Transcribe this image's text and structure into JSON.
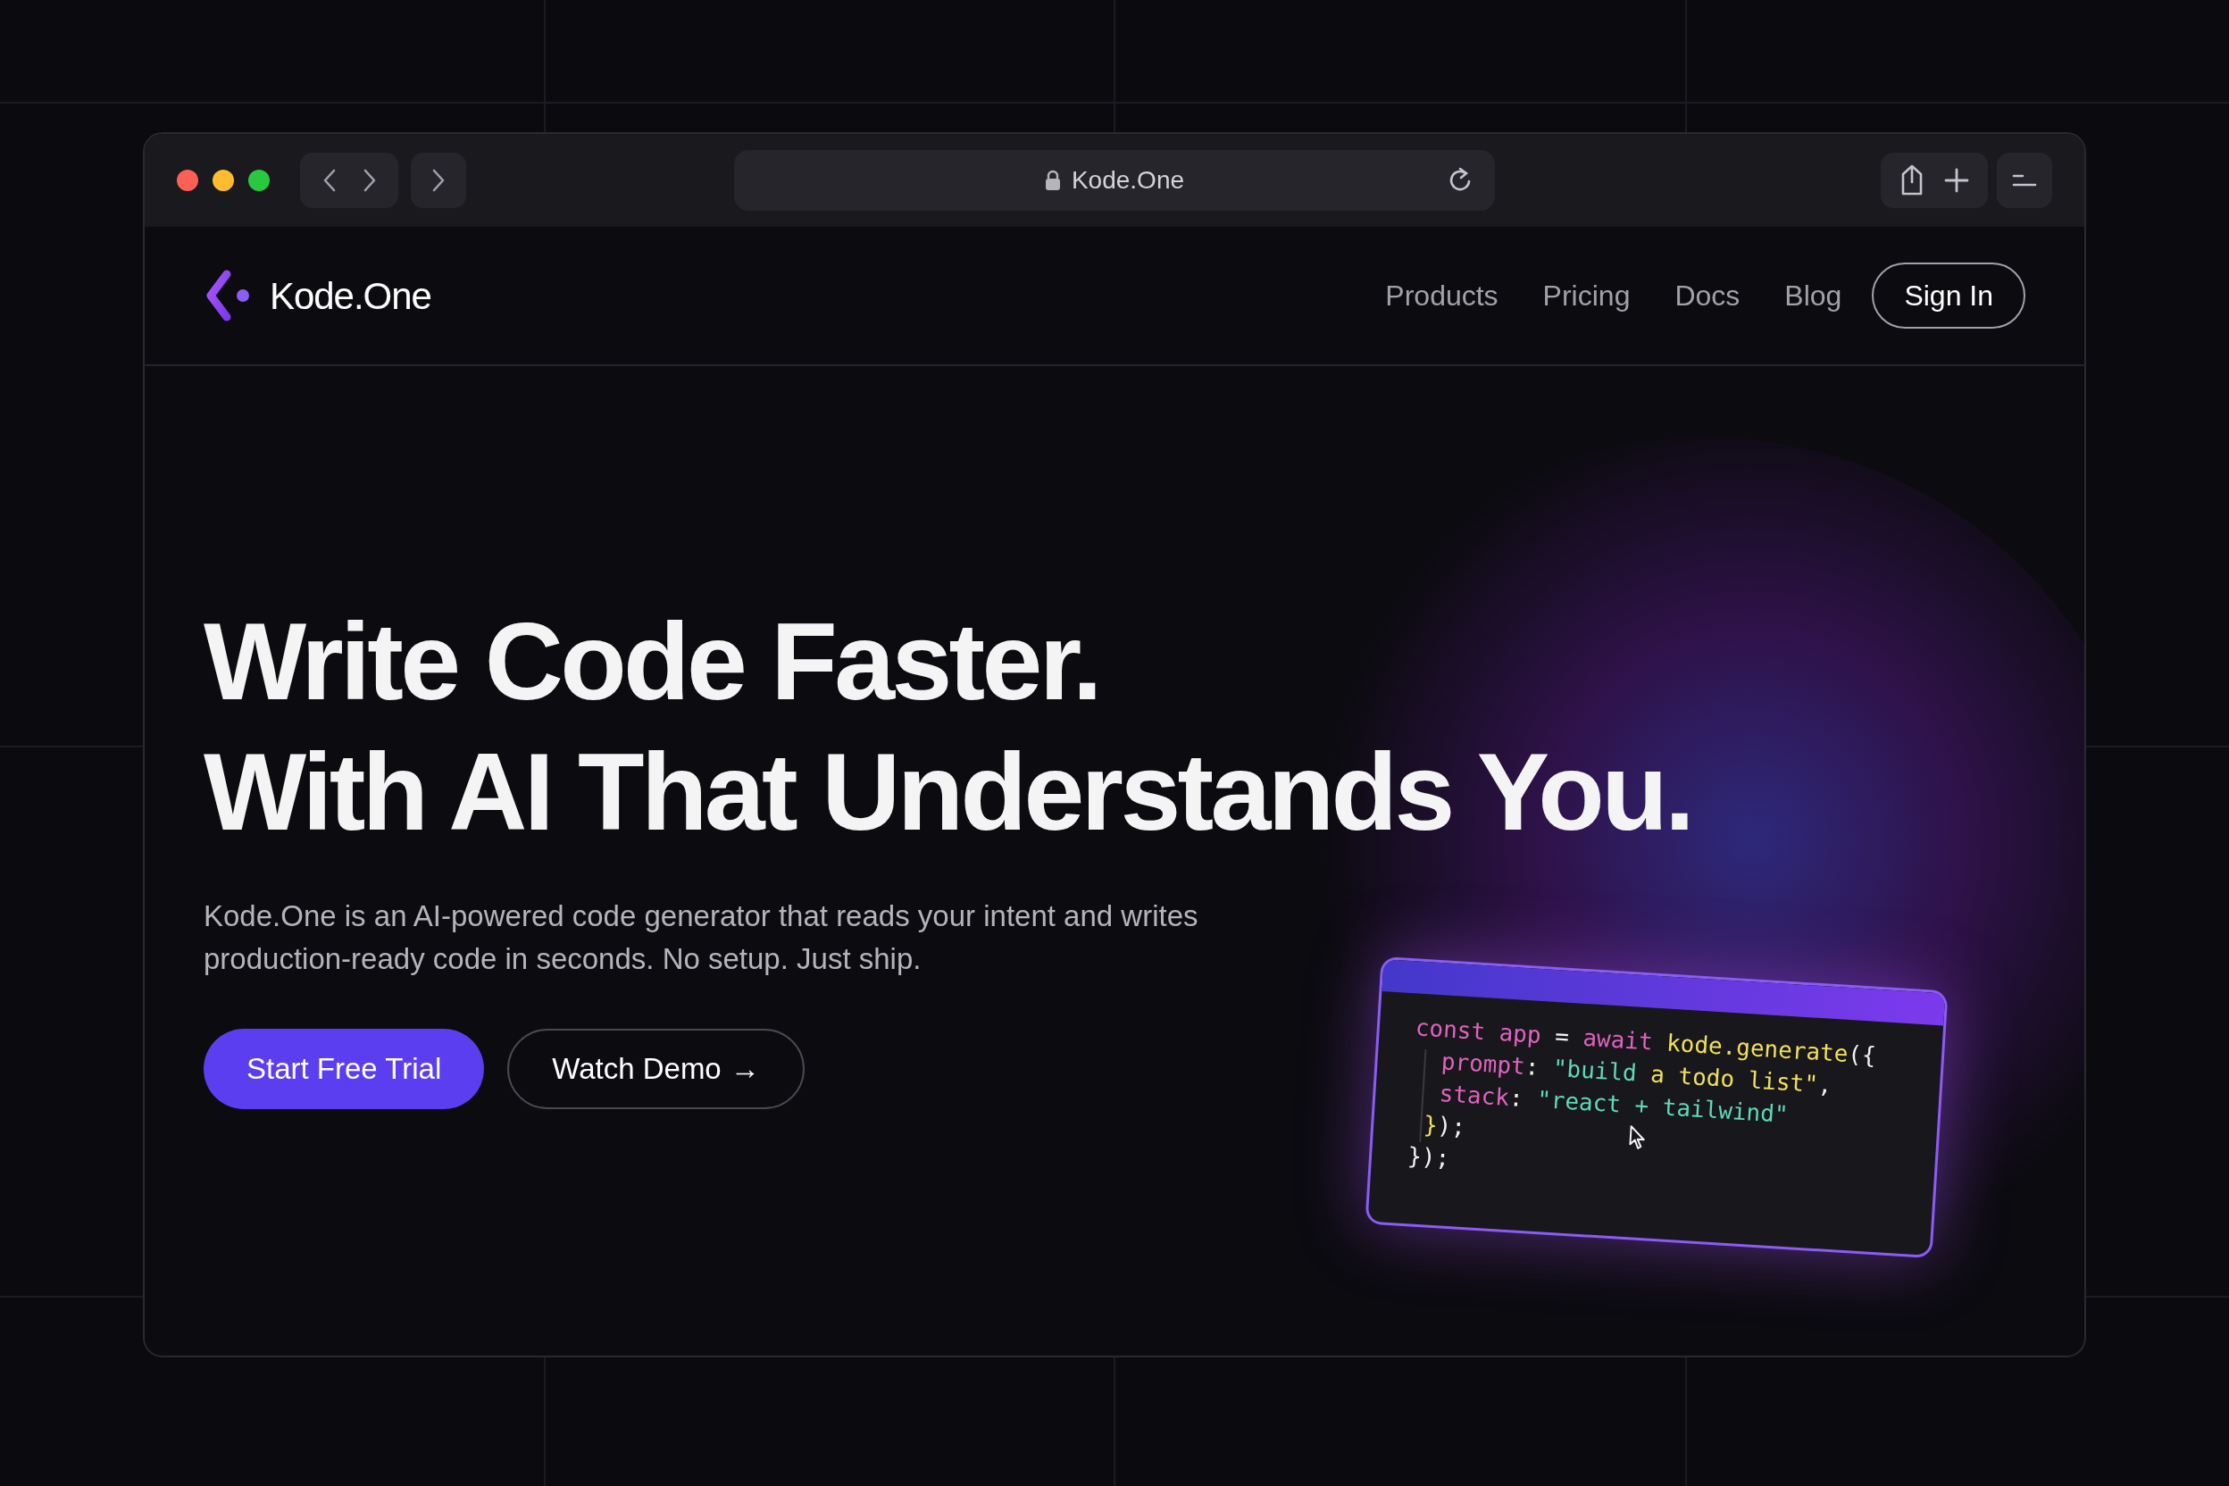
{
  "browser": {
    "address": "Kode.One"
  },
  "nav": {
    "brand": "Kode.One",
    "links": [
      "Products",
      "Pricing",
      "Docs",
      "Blog"
    ],
    "sign_in": "Sign In"
  },
  "hero": {
    "title_lines": [
      "Write Code Faster.",
      "With AI That Understands You."
    ],
    "description": "Kode.One is an AI-powered code generator that reads your intent and writes production-ready code in seconds. No setup. Just ship.",
    "primary_button": "Start Free Trial",
    "secondary_button": "Watch Demo",
    "secondary_arrow": "→"
  },
  "code_card": {
    "lines": [
      [
        {
          "text": "const app",
          "color": "#e062c0"
        },
        {
          "text": " = ",
          "color": "#f2f2f2"
        },
        {
          "text": "await",
          "color": "#e062c0"
        },
        {
          "text": " kode.generate",
          "color": "#f1e05a"
        },
        {
          "text": "({",
          "color": "#f2f2f2"
        }
      ],
      [
        {
          "text": "  prompt",
          "color": "#e062c0"
        },
        {
          "text": ": ",
          "color": "#f2f2f2"
        },
        {
          "text": "\"build",
          "color": "#5fd9b8"
        },
        {
          "text": " a todo list\"",
          "color": "#f1e05a"
        },
        {
          "text": ",",
          "color": "#f2f2f2"
        }
      ],
      [
        {
          "text": "  stack",
          "color": "#e062c0"
        },
        {
          "text": ": ",
          "color": "#f2f2f2"
        },
        {
          "text": "\"react + tailwind\"",
          "color": "#5fd9b8"
        }
      ],
      [
        {
          "text": " }",
          "color": "#f1e05a"
        },
        {
          "text": ");",
          "color": "#f2f2f2"
        }
      ],
      [
        {
          "text": "});",
          "color": "#f2f2f2"
        }
      ]
    ]
  }
}
